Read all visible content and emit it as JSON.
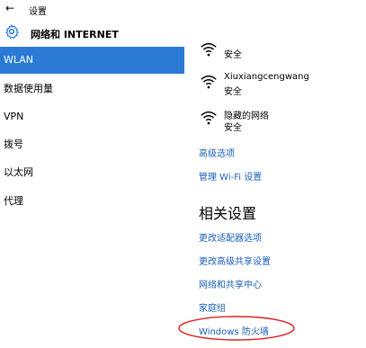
{
  "titlebar": {
    "back_glyph": "←",
    "title": "设置"
  },
  "header": {
    "title": "网络和 INTERNET",
    "icon": "gear-icon"
  },
  "sidebar": {
    "items": [
      {
        "label": "WLAN",
        "active": true
      },
      {
        "label": "数据使用量",
        "active": false
      },
      {
        "label": "VPN",
        "active": false
      },
      {
        "label": "拨号",
        "active": false
      },
      {
        "label": "以太网",
        "active": false
      },
      {
        "label": "代理",
        "active": false
      }
    ]
  },
  "networks": [
    {
      "name": "",
      "status": "安全"
    },
    {
      "name": "Xiuxiangcengwang",
      "status": "安全"
    },
    {
      "name": "隐藏的网络",
      "status": "安全"
    }
  ],
  "links": {
    "advanced": "高级选项",
    "manage_wifi": "管理 Wi-Fi 设置"
  },
  "related": {
    "title": "相关设置",
    "links": [
      "更改适配器选项",
      "更改高级共享设置",
      "网络和共享中心",
      "家庭组",
      "Windows 防火墙"
    ]
  },
  "colors": {
    "accent": "#2b7bd6",
    "link": "#1a5fb4",
    "highlight_ellipse": "#e02020"
  }
}
